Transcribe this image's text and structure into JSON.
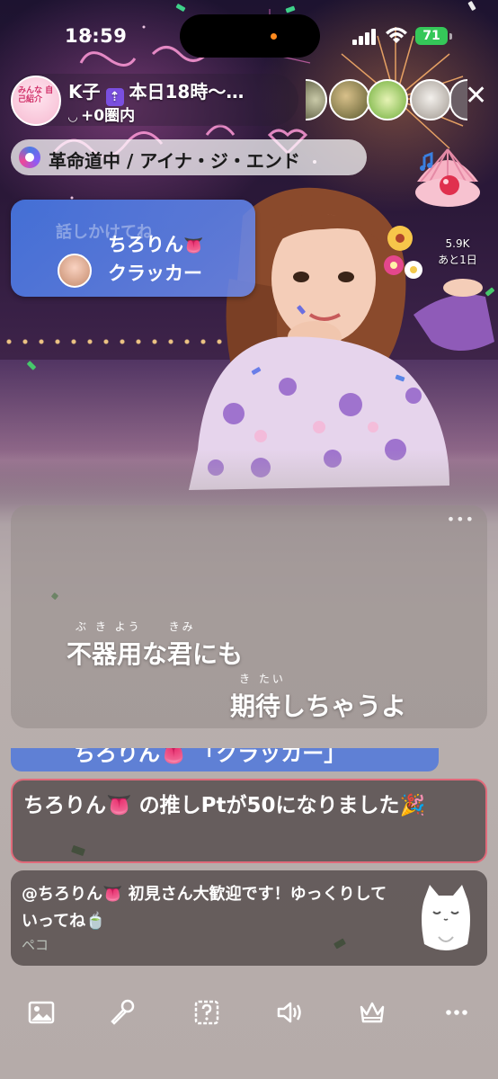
{
  "status_bar": {
    "time": "18:59",
    "battery": "71"
  },
  "header": {
    "host_name_prefix": "K子",
    "host_name_suffix": "本日18時〜…",
    "host_sub": "+0圏内",
    "avatar_text": "みんな 自己紹介",
    "close_label": "✕"
  },
  "song": {
    "title": "革命道中 / アイナ・ジ・エンド"
  },
  "gift": {
    "user": "ちろりん",
    "user_emoji": "👅",
    "item": "クラッカー",
    "bg_text": "話しかけてね"
  },
  "event_badge": {
    "count": "5.9K",
    "remaining": "あと1日"
  },
  "lyrics": {
    "more_label": "•••",
    "line1": "不器用な君にも",
    "line1_ruby": "ぶ き よう　　きみ",
    "line2": "期待しちゃうよ",
    "line2_ruby": "き たい"
  },
  "chat": {
    "partial_banner": "ちろりん👅 「クラッカー」",
    "system_message": "ちろりん👅 の推しPtが50になりました🎉",
    "message_text": "@ちろりん👅 初見さん大歓迎です！ゆっくりしていってね🍵",
    "message_author": "ペコ"
  },
  "toolbar": {
    "icons": [
      "image-icon",
      "microphone-icon",
      "quiz-icon",
      "speaker-icon",
      "crown-icon",
      "more-icon"
    ]
  },
  "colors": {
    "battery_green": "#35c759",
    "system_border": "#e06a7a",
    "gift_blue": "#4678e6"
  }
}
